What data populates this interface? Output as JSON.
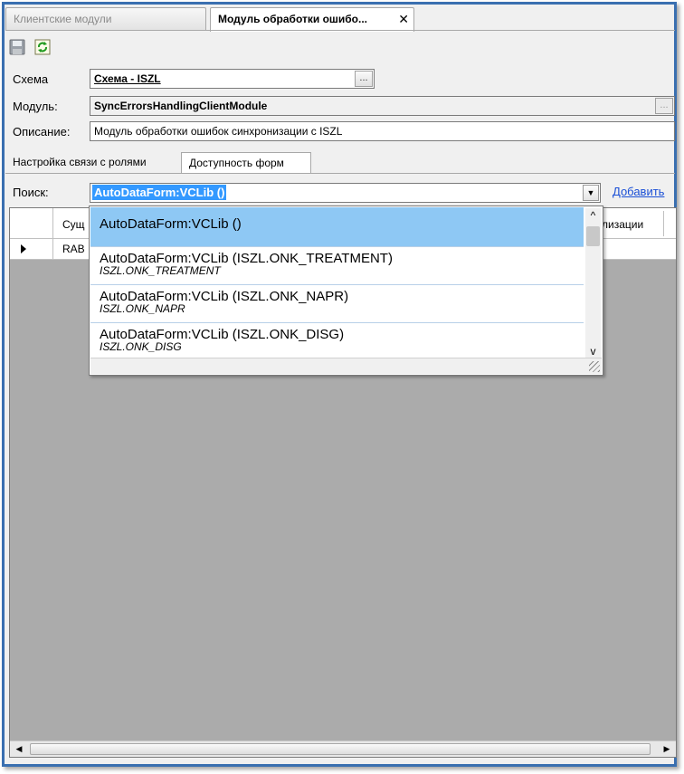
{
  "tabs": [
    {
      "label": "Клиентские модули",
      "active": false
    },
    {
      "label": "Модуль обработки ошибо...",
      "active": true
    }
  ],
  "tab_close_icon": "✕",
  "toolbar": {
    "save_icon": "save-icon",
    "refresh_icon": "refresh-icon"
  },
  "form": {
    "schema_label": "Схема",
    "schema_value": "Схема - ISZL",
    "module_label": "Модуль:",
    "module_value": "SyncErrorsHandlingClientModule",
    "description_label": "Описание:",
    "description_value": "Модуль обработки ошибок синхронизации с ISZL",
    "ellipsis": "..."
  },
  "subtabs": [
    {
      "label": "Настройка связи с ролями",
      "active": false
    },
    {
      "label": "Доступность форм",
      "active": true
    }
  ],
  "search": {
    "label": "Поиск:",
    "value": "AutoDataForm:VCLib ()",
    "add_link": "Добавить"
  },
  "grid": {
    "columns": [
      "Сущ",
      "лизации"
    ],
    "rows": [
      {
        "cell": "RAB"
      }
    ]
  },
  "dropdown": {
    "items": [
      {
        "main": "AutoDataForm:VCLib ()",
        "sub": "",
        "selected": true
      },
      {
        "main": "AutoDataForm:VCLib  (ISZL.ONK_TREATMENT)",
        "sub": "ISZL.ONK_TREATMENT",
        "selected": false
      },
      {
        "main": "AutoDataForm:VCLib (ISZL.ONK_NAPR)",
        "sub": "ISZL.ONK_NAPR",
        "selected": false
      },
      {
        "main": "AutoDataForm:VCLib (ISZL.ONK_DISG)",
        "sub": "ISZL.ONK_DISG",
        "selected": false
      }
    ]
  },
  "colors": {
    "frame": "#3a6fb0",
    "selection": "#3399ff",
    "dropdown_selected": "#8ec8f4",
    "link": "#1a4fd6",
    "grid_bg": "#ababab"
  }
}
